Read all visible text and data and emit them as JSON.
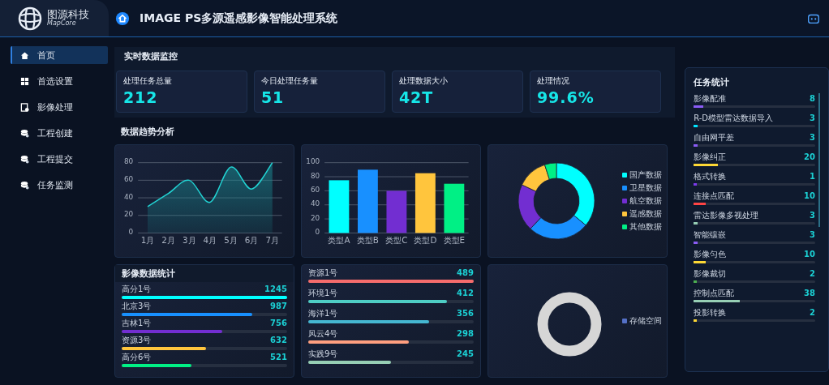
{
  "brand": {
    "name": "图源科技",
    "sub": "MapCore"
  },
  "header": {
    "title": "IMAGE PS多源遥感影像智能处理系统"
  },
  "sidebar": {
    "items": [
      {
        "label": "首页",
        "selected": true
      },
      {
        "label": "首选设置",
        "selected": false
      },
      {
        "label": "影像处理",
        "selected": false
      },
      {
        "label": "工程创建",
        "selected": false
      },
      {
        "label": "工程提交",
        "selected": false
      },
      {
        "label": "任务监测",
        "selected": false
      }
    ]
  },
  "monitor": {
    "title": "实时数据监控",
    "stats": [
      {
        "label": "处理任务总量",
        "value": "212"
      },
      {
        "label": "今日处理任务量",
        "value": "51"
      },
      {
        "label": "处理数据大小",
        "value": "42T"
      },
      {
        "label": "处理情况",
        "value": "99.6%"
      }
    ]
  },
  "trend": {
    "title": "数据趋势分析",
    "line_chart": {
      "chart_data": {
        "type": "area",
        "x": [
          "1月",
          "2月",
          "3月",
          "4月",
          "5月",
          "6月",
          "7月"
        ],
        "series": [
          {
            "color": "#22d3d3",
            "values": [
              30,
              45,
              60,
              35,
              75,
              50,
              80
            ]
          }
        ],
        "grid": true,
        "ylim": [
          0,
          80
        ],
        "yticks": [
          0,
          20,
          40,
          60,
          80
        ]
      }
    },
    "bar_chart": {
      "chart_data": {
        "type": "bar",
        "categories": [
          "类型A",
          "类型B",
          "类型C",
          "类型D",
          "类型E"
        ],
        "values": [
          75,
          90,
          60,
          85,
          70
        ],
        "colors": [
          "#00ffff",
          "#1890ff",
          "#722ed1",
          "#ffc53d",
          "#00f085"
        ],
        "grid": true,
        "ylim": [
          0,
          100
        ],
        "yticks": [
          0,
          20,
          40,
          60,
          80,
          100
        ]
      }
    },
    "donut": {
      "kind": "picture",
      "legend": [
        {
          "label": "国产数据",
          "color": "#00ffff"
        },
        {
          "label": "卫星数据",
          "color": "#1890ff"
        },
        {
          "label": "航空数据",
          "color": "#722ed1"
        },
        {
          "label": "遥感数据",
          "color": "#ffc53d"
        },
        {
          "label": "其他数据",
          "color": "#00f085"
        }
      ]
    },
    "image_stats": {
      "title": "影像数据统计",
      "rows": [
        {
          "name": "高分1号",
          "value": "1245",
          "level": 1,
          "color": "#00ffff"
        },
        {
          "name": "北京3号",
          "value": "987",
          "level": 0.79,
          "color": "#1890ff"
        },
        {
          "name": "吉林1号",
          "value": "756",
          "level": 0.61,
          "color": "#722ed1"
        },
        {
          "name": "资源3号",
          "value": "632",
          "level": 0.51,
          "color": "#ffc53d"
        },
        {
          "name": "高分6号",
          "value": "521",
          "level": 0.42,
          "color": "#00f085"
        }
      ]
    },
    "satellite_stats": {
      "rows": [
        {
          "name": "资源1号",
          "value": "489",
          "level": 1,
          "color": "#f56c6c"
        },
        {
          "name": "环境1号",
          "value": "412",
          "level": 0.84,
          "color": "#4ecdc4"
        },
        {
          "name": "海洋1号",
          "value": "356",
          "level": 0.73,
          "color": "#45b7d1"
        },
        {
          "name": "风云4号",
          "value": "298",
          "level": 0.61,
          "color": "#ff9f7f"
        },
        {
          "name": "实践9号",
          "value": "245",
          "level": 0.5,
          "color": "#96ceb4"
        }
      ]
    },
    "storage": {
      "kind": "picture",
      "legend": [
        {
          "label": "存储空间",
          "color": "#5470c6"
        }
      ]
    }
  },
  "tasks": {
    "title": "任务统计",
    "rows": [
      {
        "name": "影像配准",
        "value": "8",
        "level": 0.08,
        "color": "#8b5cf6"
      },
      {
        "name": "R-D模型雷达数据导入",
        "value": "3",
        "level": 0.03,
        "color": "#00e5ff"
      },
      {
        "name": "自由网平差",
        "value": "3",
        "level": 0.03,
        "color": "#8b5cf6"
      },
      {
        "name": "影像纠正",
        "value": "20",
        "level": 0.2,
        "color": "#fdd835"
      },
      {
        "name": "格式转换",
        "value": "1",
        "level": 0.01,
        "color": "#7c3aed"
      },
      {
        "name": "连接点匹配",
        "value": "10",
        "level": 0.1,
        "color": "#ff4444"
      },
      {
        "name": "雷达影像多视处理",
        "value": "3",
        "level": 0.03,
        "color": "#96ceb4"
      },
      {
        "name": "智能镶嵌",
        "value": "3",
        "level": 0.03,
        "color": "#8b5cf6"
      },
      {
        "name": "影像匀色",
        "value": "10",
        "level": 0.1,
        "color": "#fdd835"
      },
      {
        "name": "影像裁切",
        "value": "2",
        "level": 0.02,
        "color": "#4caf50"
      },
      {
        "name": "控制点匹配",
        "value": "38",
        "level": 0.38,
        "color": "#96ceb4"
      },
      {
        "name": "投影转换",
        "value": "2",
        "level": 0.02,
        "color": "#fdd835"
      }
    ]
  }
}
